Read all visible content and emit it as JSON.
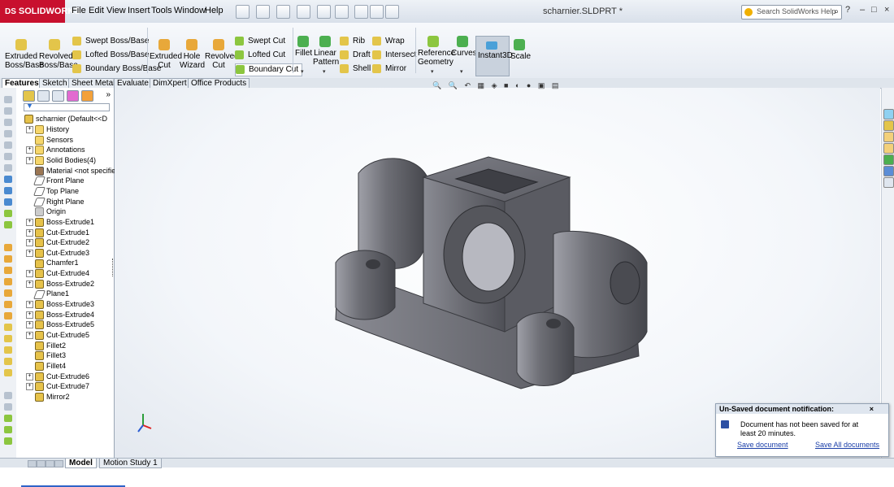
{
  "app": {
    "logo_text": "SOLIDWORKS",
    "logo_mark": "DS"
  },
  "menu": {
    "items": [
      "File",
      "Edit",
      "View",
      "Insert",
      "Tools",
      "Window",
      "Help"
    ]
  },
  "document_title": "scharnier.SLDPRT *",
  "help_search": {
    "placeholder": "Search SolidWorks Help",
    "icon": "search-icon"
  },
  "window_controls": {
    "help_glyph": "?",
    "min_glyph": "–",
    "restore_glyph": "□",
    "close_glyph": "×"
  },
  "command_manager": {
    "extruded_boss": "Extruded Boss/Base",
    "revolved_boss": "Revolved Boss/Base",
    "swept_boss": "Swept Boss/Base",
    "lofted_boss": "Lofted Boss/Base",
    "boundary_boss": "Boundary Boss/Base",
    "extruded_cut": "Extruded Cut",
    "hole_wizard": "Hole Wizard",
    "revolved_cut": "Revolved Cut",
    "swept_cut": "Swept Cut",
    "lofted_cut": "Lofted Cut",
    "boundary_cut": "Boundary Cut",
    "fillet": "Fillet",
    "linear_pattern": "Linear Pattern",
    "rib": "Rib",
    "draft": "Draft",
    "shell": "Shell",
    "wrap": "Wrap",
    "intersect": "Intersect",
    "mirror": "Mirror",
    "reference_geometry": "Reference Geometry",
    "curves": "Curves",
    "instant3d": "Instant3D",
    "scale": "Scale",
    "dropdown_glyph": "▾"
  },
  "tabs": [
    "Features",
    "Sketch",
    "Sheet Metal",
    "Evaluate",
    "DimXpert",
    "Office Products"
  ],
  "feature_tree": {
    "root": "scharnier  (Default<<D",
    "expand_glyph": "+",
    "items": [
      {
        "label": "History",
        "kind": "folder",
        "expand": true
      },
      {
        "label": "Sensors",
        "kind": "folder",
        "expand": false
      },
      {
        "label": "Annotations",
        "kind": "folder",
        "expand": true
      },
      {
        "label": "Solid Bodies(4)",
        "kind": "folder",
        "expand": true
      },
      {
        "label": "Material <not specifie",
        "kind": "mat",
        "expand": false
      },
      {
        "label": "Front Plane",
        "kind": "plane",
        "expand": false
      },
      {
        "label": "Top Plane",
        "kind": "plane",
        "expand": false
      },
      {
        "label": "Right Plane",
        "kind": "plane",
        "expand": false
      },
      {
        "label": "Origin",
        "kind": "gray",
        "expand": false
      },
      {
        "label": "Boss-Extrude1",
        "kind": "feat",
        "expand": true
      },
      {
        "label": "Cut-Extrude1",
        "kind": "feat",
        "expand": true
      },
      {
        "label": "Cut-Extrude2",
        "kind": "feat",
        "expand": true
      },
      {
        "label": "Cut-Extrude3",
        "kind": "feat",
        "expand": true
      },
      {
        "label": "Chamfer1",
        "kind": "feat",
        "expand": false
      },
      {
        "label": "Cut-Extrude4",
        "kind": "feat",
        "expand": true
      },
      {
        "label": "Boss-Extrude2",
        "kind": "feat",
        "expand": true
      },
      {
        "label": "Plane1",
        "kind": "plane",
        "expand": false
      },
      {
        "label": "Boss-Extrude3",
        "kind": "feat",
        "expand": true
      },
      {
        "label": "Boss-Extrude4",
        "kind": "feat",
        "expand": true
      },
      {
        "label": "Boss-Extrude5",
        "kind": "feat",
        "expand": true
      },
      {
        "label": "Cut-Extrude5",
        "kind": "feat",
        "expand": true
      },
      {
        "label": "Fillet2",
        "kind": "feat",
        "expand": false
      },
      {
        "label": "Fillet3",
        "kind": "feat",
        "expand": false
      },
      {
        "label": "Fillet4",
        "kind": "feat",
        "expand": false
      },
      {
        "label": "Cut-Extrude6",
        "kind": "feat",
        "expand": true
      },
      {
        "label": "Cut-Extrude7",
        "kind": "feat",
        "expand": true
      },
      {
        "label": "Mirror2",
        "kind": "feat",
        "expand": false
      }
    ]
  },
  "notification": {
    "title": "Un-Saved document notification:",
    "close_glyph": "×",
    "message": "Document has not been saved for at least 20 minutes.",
    "save_link": "Save document",
    "save_all_link": "Save All documents"
  },
  "bottom_tabs": [
    "Model",
    "Motion Study 1"
  ],
  "colors": {
    "brand": "#c8102e",
    "link": "#1a3ea8",
    "part_gray": "#6e6f76"
  }
}
